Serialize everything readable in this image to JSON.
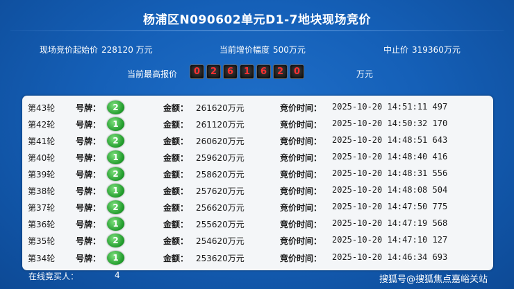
{
  "title": "杨浦区N090602单元D1-7地块现场竞价",
  "info": {
    "start_label": "现场竞价起始价",
    "start_value": "228120 万元",
    "increment_label": "当前增价幅度",
    "increment_value": "500万元",
    "stop_label": "中止价",
    "stop_value": "319360万元"
  },
  "highest": {
    "label": "当前最高报价",
    "digits": [
      "0",
      "2",
      "6",
      "1",
      "6",
      "2",
      "0"
    ],
    "unit": "万元"
  },
  "labels": {
    "plate": "号牌：",
    "amount": "金额：",
    "time": "竞价时间："
  },
  "rows": [
    {
      "round": "第43轮",
      "plate": "2",
      "amount": "261620万元",
      "time": "2025-10-20 14:51:11 497"
    },
    {
      "round": "第42轮",
      "plate": "1",
      "amount": "261120万元",
      "time": "2025-10-20 14:50:32 170"
    },
    {
      "round": "第41轮",
      "plate": "2",
      "amount": "260620万元",
      "time": "2025-10-20 14:48:51 643"
    },
    {
      "round": "第40轮",
      "plate": "1",
      "amount": "259620万元",
      "time": "2025-10-20 14:48:40 416"
    },
    {
      "round": "第39轮",
      "plate": "2",
      "amount": "258620万元",
      "time": "2025-10-20 14:48:31 556"
    },
    {
      "round": "第38轮",
      "plate": "1",
      "amount": "257620万元",
      "time": "2025-10-20 14:48:08 504"
    },
    {
      "round": "第37轮",
      "plate": "2",
      "amount": "256620万元",
      "time": "2025-10-20 14:47:50 775"
    },
    {
      "round": "第36轮",
      "plate": "1",
      "amount": "255620万元",
      "time": "2025-10-20 14:47:19 568"
    },
    {
      "round": "第35轮",
      "plate": "2",
      "amount": "254620万元",
      "time": "2025-10-20 14:47:10 127"
    },
    {
      "round": "第34轮",
      "plate": "1",
      "amount": "253620万元",
      "time": "2025-10-20 14:46:34 693"
    }
  ],
  "footer": {
    "online_label": "在线竞买人：",
    "online_count": "4"
  },
  "watermark": "搜狐号@搜狐焦点嘉峪关站"
}
